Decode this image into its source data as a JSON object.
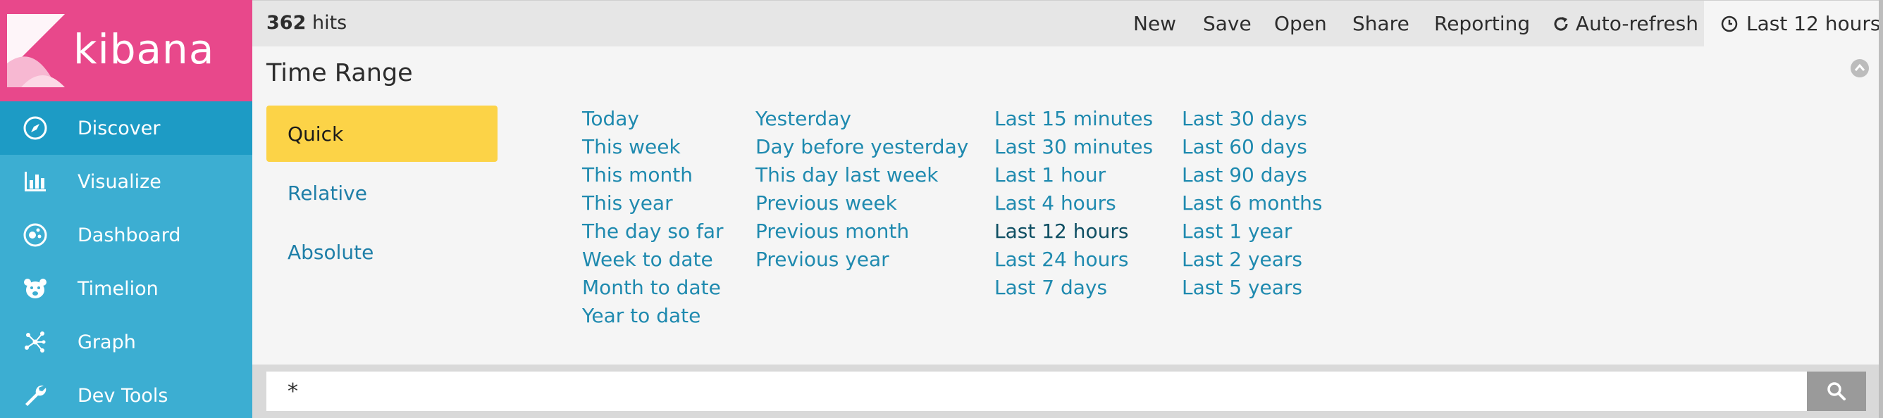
{
  "brand": {
    "name": "kibana",
    "logo_icon": "kibana-logo-icon"
  },
  "sidebar": {
    "items": [
      {
        "label": "Discover",
        "icon": "compass-icon",
        "active": true
      },
      {
        "label": "Visualize",
        "icon": "bar-chart-icon",
        "active": false
      },
      {
        "label": "Dashboard",
        "icon": "dashboard-gauge-icon",
        "active": false
      },
      {
        "label": "Timelion",
        "icon": "timelion-bear-icon",
        "active": false
      },
      {
        "label": "Graph",
        "icon": "graph-network-icon",
        "active": false
      },
      {
        "label": "Dev Tools",
        "icon": "wrench-icon",
        "active": false
      }
    ]
  },
  "topbar": {
    "hits_count": "362",
    "hits_label": "hits",
    "menu": [
      "New",
      "Save",
      "Open",
      "Share",
      "Reporting"
    ],
    "auto_refresh": "Auto-refresh",
    "time_picker": "Last 12 hours"
  },
  "time_range": {
    "title": "Time Range",
    "modes": [
      "Quick",
      "Relative",
      "Absolute"
    ],
    "active_mode": "Quick",
    "columns": [
      [
        "Today",
        "This week",
        "This month",
        "This year",
        "The day so far",
        "Week to date",
        "Month to date",
        "Year to date"
      ],
      [
        "Yesterday",
        "Day before yesterday",
        "This day last week",
        "Previous week",
        "Previous month",
        "Previous year"
      ],
      [
        "Last 15 minutes",
        "Last 30 minutes",
        "Last 1 hour",
        "Last 4 hours",
        "Last 12 hours",
        "Last 24 hours",
        "Last 7 days"
      ],
      [
        "Last 30 days",
        "Last 60 days",
        "Last 90 days",
        "Last 6 months",
        "Last 1 year",
        "Last 2 years",
        "Last 5 years"
      ]
    ],
    "selected": "Last 12 hours"
  },
  "search": {
    "query": "*"
  },
  "colors": {
    "brand_pink": "#e8488b",
    "sidebar_blue": "#3caed2",
    "sidebar_active": "#1d9bc5",
    "quick_yellow": "#fcd347",
    "link_blue": "#1f8aaf"
  }
}
